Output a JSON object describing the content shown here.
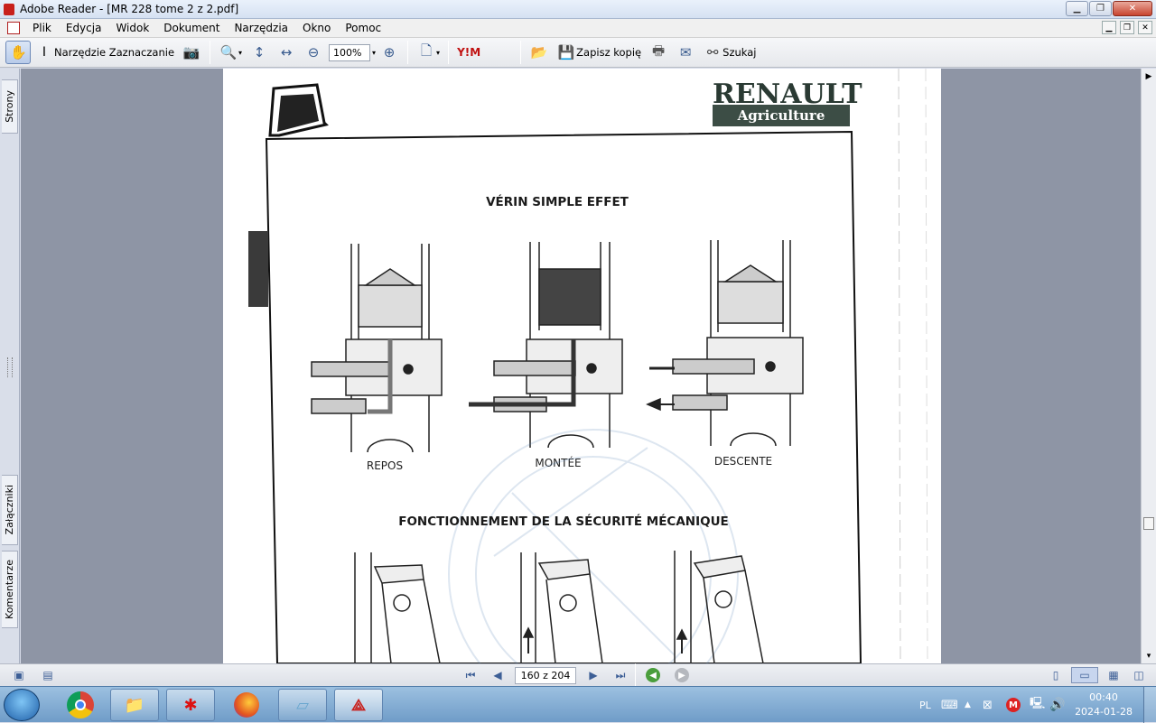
{
  "window": {
    "title": "Adobe Reader - [MR 228 tome 2 z 2.pdf]"
  },
  "menu": {
    "items": [
      "Plik",
      "Edycja",
      "Widok",
      "Dokument",
      "Narzędzia",
      "Okno",
      "Pomoc"
    ]
  },
  "toolbar": {
    "select_tool_label": "Narzędzie Zaznaczanie",
    "zoom_value": "100%",
    "save_copy_label": "Zapisz kopię",
    "search_label": "Szukaj",
    "ya_label": "Y!M"
  },
  "side_tabs": {
    "pages": "Strony",
    "attachments": "Załączniki",
    "comments": "Komentarze"
  },
  "document": {
    "brand": "RENAULT",
    "brand_sub": "Agriculture",
    "heading1": "VÉRIN SIMPLE EFFET",
    "labels": [
      "REPOS",
      "MONTÉE",
      "DESCENTE"
    ],
    "heading2": "FONCTIONNEMENT DE LA SÉCURITÉ MÉCANIQUE"
  },
  "navigation": {
    "page_indicator": "160 z 204"
  },
  "taskbar": {
    "language": "PL",
    "time": "00:40",
    "date": "2024-01-28"
  }
}
